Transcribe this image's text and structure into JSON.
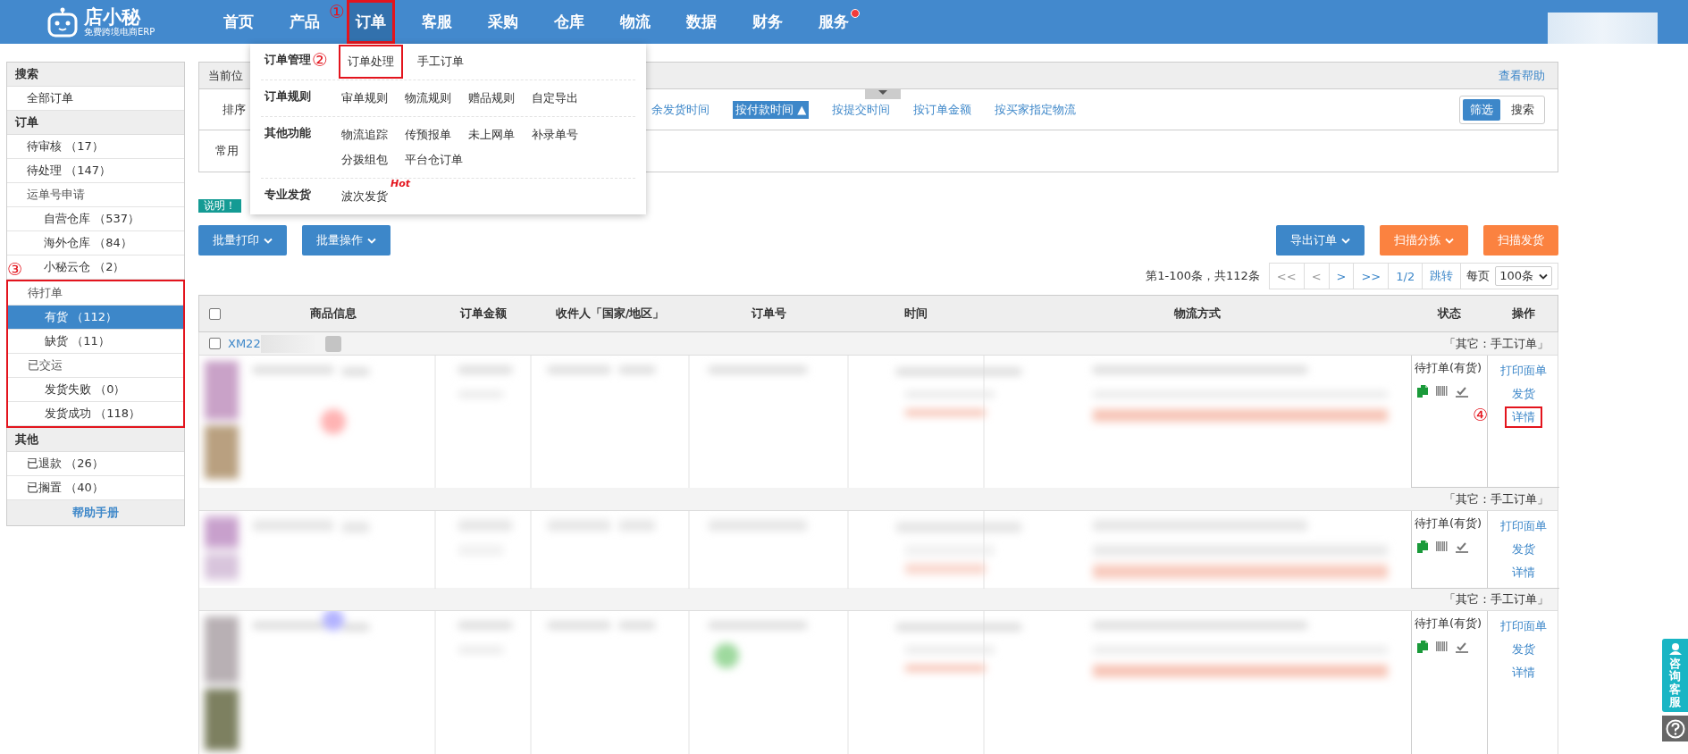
{
  "top_nav": {
    "logo_text": "店小秘",
    "logo_subtitle": "免费跨境电商ERP",
    "items": [
      {
        "label": "首页",
        "selected": false,
        "highlighted": false,
        "notification": false
      },
      {
        "label": "产品",
        "selected": false,
        "highlighted": false,
        "notification": false
      },
      {
        "label": "订单",
        "selected": true,
        "highlighted": true,
        "notification": false,
        "annotation": "①"
      },
      {
        "label": "客服",
        "selected": false,
        "highlighted": false,
        "notification": false
      },
      {
        "label": "采购",
        "selected": false,
        "highlighted": false,
        "notification": false
      },
      {
        "label": "仓库",
        "selected": false,
        "highlighted": false,
        "notification": false
      },
      {
        "label": "物流",
        "selected": false,
        "highlighted": false,
        "notification": false
      },
      {
        "label": "数据",
        "selected": false,
        "highlighted": false,
        "notification": false
      },
      {
        "label": "财务",
        "selected": false,
        "highlighted": false,
        "notification": false
      },
      {
        "label": "服务",
        "selected": false,
        "highlighted": false,
        "notification": true
      }
    ]
  },
  "order_menu": {
    "sections": [
      {
        "title": "订单管理",
        "rows": [
          [
            {
              "label": "订单处理",
              "highlighted": true,
              "annotation": "②"
            },
            {
              "label": "手工订单",
              "highlighted": false
            }
          ]
        ]
      },
      {
        "title": "订单规则",
        "rows": [
          [
            {
              "label": "审单规则",
              "highlighted": false
            },
            {
              "label": "物流规则",
              "highlighted": false
            },
            {
              "label": "赠品规则",
              "highlighted": false
            },
            {
              "label": "自定导出",
              "highlighted": false
            }
          ]
        ]
      },
      {
        "title": "其他功能",
        "rows": [
          [
            {
              "label": "物流追踪",
              "highlighted": false
            },
            {
              "label": "传预报单",
              "highlighted": false
            },
            {
              "label": "未上网单",
              "highlighted": false
            },
            {
              "label": "补录单号",
              "highlighted": false
            }
          ],
          [
            {
              "label": "分拨组包",
              "highlighted": false
            },
            {
              "label": "平台仓订单",
              "highlighted": false
            }
          ]
        ]
      },
      {
        "title": "专业发货",
        "rows": [
          [
            {
              "label": "波次发货",
              "highlighted": false,
              "badge": "Hot"
            }
          ]
        ]
      }
    ]
  },
  "sidebar": {
    "sections": [
      {
        "title": "搜索",
        "highlighted": false,
        "items": [
          {
            "label": "全部订单",
            "selected": false
          }
        ]
      },
      {
        "title": "订单",
        "highlighted": false,
        "items": [
          {
            "label": "待审核 （17）",
            "selected": false
          },
          {
            "label": "待处理 （147）",
            "selected": false
          },
          {
            "label": "运单号申请",
            "selected": false,
            "children": [
              {
                "label": "自营仓库 （537）",
                "selected": false
              },
              {
                "label": "海外仓库 （84）",
                "selected": false
              },
              {
                "label": "小秘云仓 （2）",
                "selected": false
              }
            ]
          }
        ]
      },
      {
        "highlighted": true,
        "annotation": "③",
        "items": [
          {
            "label": "待打单",
            "selected": false,
            "children": [
              {
                "label": "有货 （112）",
                "selected": true
              },
              {
                "label": "缺货 （11）",
                "selected": false
              }
            ]
          },
          {
            "label": "已交运",
            "selected": false,
            "children": [
              {
                "label": "发货失败 （0）",
                "selected": false
              },
              {
                "label": "发货成功 （118）",
                "selected": false
              }
            ]
          }
        ]
      },
      {
        "title": "其他",
        "highlighted": false,
        "items": [
          {
            "label": "已退款 （26）",
            "selected": false
          },
          {
            "label": "已搁置 （40）",
            "selected": false
          }
        ]
      }
    ],
    "help_link": "帮助手册"
  },
  "breadcrumb": {
    "label": "当前位",
    "help_link": "查看帮助"
  },
  "sort_bar": {
    "label": "排序",
    "options": [
      {
        "label": "余发货时间",
        "selected": false
      },
      {
        "label": "按付款时间",
        "selected": true,
        "arrow": "▲"
      },
      {
        "label": "按提交时间",
        "selected": false
      },
      {
        "label": "按订单金额",
        "selected": false
      },
      {
        "label": "按买家指定物流",
        "selected": false
      }
    ],
    "view_toggle": [
      {
        "label": "筛选",
        "selected": true
      },
      {
        "label": "搜索",
        "selected": false
      }
    ]
  },
  "filter_bar": {
    "label": "常用"
  },
  "notice_badge": "说明！",
  "actions_left": [
    {
      "label": "批量打印",
      "dropdown": true
    },
    {
      "label": "批量操作",
      "dropdown": true
    }
  ],
  "actions_right": [
    {
      "label": "导出订单",
      "dropdown": true,
      "color": "#3d87c9"
    },
    {
      "label": "扫描分拣",
      "dropdown": true,
      "color": "#fb8240"
    },
    {
      "label": "扫描发货",
      "dropdown": false,
      "color": "#fb8240"
    }
  ],
  "pagination": {
    "summary": "第1-100条，共112条",
    "buttons": [
      {
        "label": "<<",
        "disabled": true
      },
      {
        "label": "<",
        "disabled": true
      },
      {
        "label": ">",
        "disabled": false
      },
      {
        "label": ">>",
        "disabled": false
      },
      {
        "label": "1/2",
        "disabled": false
      },
      {
        "label": "跳转",
        "disabled": false
      }
    ],
    "per_page_label": "每页",
    "per_page_value": "100条"
  },
  "table": {
    "select_all_checked": false,
    "columns": [
      "商品信息",
      "订单金额",
      "收件人「国家/地区」",
      "订单号",
      "时间",
      "物流方式",
      "状态",
      "操作"
    ],
    "orders": [
      {
        "order_no": "XM22",
        "checked": false,
        "source": "「其它：手工订单」",
        "status": "待打单(有货)",
        "actions": [
          {
            "label": "打印面单",
            "highlighted": false
          },
          {
            "label": "发货",
            "highlighted": false
          },
          {
            "label": "详情",
            "highlighted": true,
            "annotation": "④"
          }
        ]
      },
      {
        "source": "「其它：手工订单」",
        "status": "待打单(有货)",
        "actions": [
          {
            "label": "打印面单",
            "highlighted": false
          },
          {
            "label": "发货",
            "highlighted": false
          },
          {
            "label": "详情",
            "highlighted": false
          }
        ]
      },
      {
        "source": "「其它：手工订单」",
        "status": "待打单(有货)",
        "actions": [
          {
            "label": "打印面单",
            "highlighted": false
          },
          {
            "label": "发货",
            "highlighted": false
          },
          {
            "label": "详情",
            "highlighted": false
          }
        ]
      }
    ]
  },
  "support": {
    "label": "咨询客服"
  }
}
